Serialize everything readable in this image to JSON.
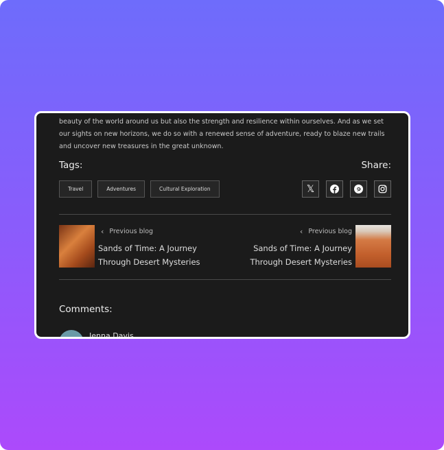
{
  "article": {
    "paragraph": "beauty of the world around us but also the strength and resilience within ourselves. And as we set our sights on new horizons, we do so with a renewed sense of adventure, ready to blaze new trails and uncover new treasures in the great unknown."
  },
  "tags": {
    "label": "Tags:",
    "items": [
      "Travel",
      "Adventures",
      "Cultural Exploration"
    ]
  },
  "share": {
    "label": "Share:",
    "icons": [
      "x-icon",
      "facebook-icon",
      "pinterest-icon",
      "instagram-icon"
    ]
  },
  "nav": {
    "left": {
      "label": "Previous blog",
      "title": "Sands of Time: A Journey Through Desert Mysteries"
    },
    "right": {
      "label": "Previous blog",
      "title": "Sands of Time: A Journey Through Desert Mysteries"
    }
  },
  "comments": {
    "label": "Comments:",
    "first_author": "Jenna Davis"
  },
  "colors": {
    "bg_top": "#6e6cfb",
    "bg_bottom": "#ac4afb",
    "card": "#1b1b1b"
  }
}
